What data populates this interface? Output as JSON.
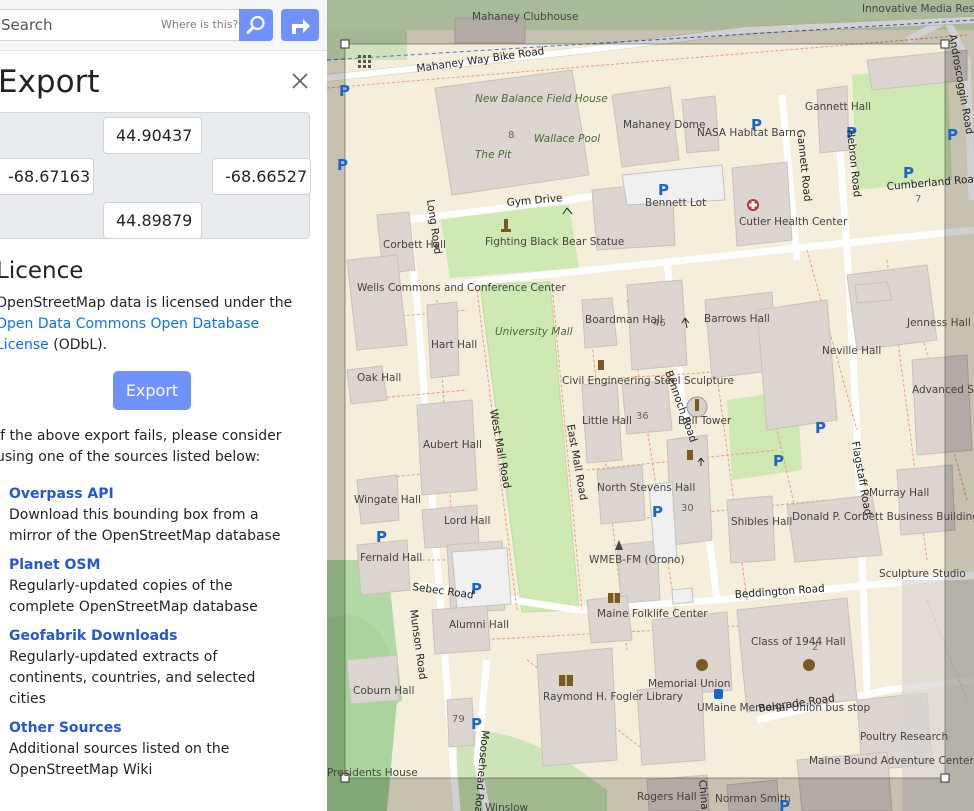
{
  "search": {
    "placeholder": "Search",
    "where_label": "Where is this?"
  },
  "export_panel": {
    "title": "Export",
    "max_lat": "44.90437",
    "min_lon": "-68.67163",
    "max_lon": "-68.66527",
    "min_lat": "44.89879",
    "licence_title": "Licence",
    "licence_prefix": "OpenStreetMap data is licensed under the",
    "licence_link": "Open Data Commons Open Database License",
    "licence_suffix": "(ODbL).",
    "export_button": "Export",
    "fail_text": "If the above export fails, please consider using one of the sources listed below:",
    "sources": [
      {
        "name": "Overpass API",
        "desc": "Download this bounding box from a mirror of the OpenStreetMap database"
      },
      {
        "name": "Planet OSM",
        "desc": "Regularly-updated copies of the complete OpenStreetMap database"
      },
      {
        "name": "Geofabrik Downloads",
        "desc": "Regularly-updated extracts of continents, countries, and selected cities"
      },
      {
        "name": "Other Sources",
        "desc": "Additional sources listed on the OpenStreetMap Wiki"
      }
    ]
  },
  "map": {
    "labels": {
      "mahaney_clubhouse": "Mahaney Clubhouse",
      "mahaney_way": "Mahaney Way Bike Road",
      "new_balance": "New Balance Field House",
      "the_pit": "The Pit",
      "wallace_pool": "Wallace Pool",
      "mahaney_dome": "Mahaney Dome",
      "nasa_barn": "NASA Habitat Barn",
      "gannett_hall": "Gannett Hall",
      "gannett_road": "Gannett Road",
      "hebron_road": "Hebron Road",
      "innovative_media": "Innovative Media Research and Commercialization Center",
      "androscoggin": "Androscoggin Road",
      "cumberland": "Cumberland Road",
      "bennett_lot": "Bennett Lot",
      "cutler": "Cutler Health Center",
      "gym_drive": "Gym Drive",
      "long_road": "Long Road",
      "fighting_bear": "Fighting Black Bear Statue",
      "corbett": "Corbett Hall",
      "wells": "Wells Commons and Conference Center",
      "hart": "Hart Hall",
      "oak": "Oak Hall",
      "university_mall": "University Mall",
      "boardman": "Boardman Hall",
      "barrows": "Barrows Hall",
      "jenness": "Jenness Hall",
      "neville": "Neville Hall",
      "civil_eng": "Civil Engineering Steel Sculpture",
      "bennoch": "Bennoch Road",
      "bell_tower": "Bell Tower",
      "advanced": "Advanced Structures and Composites Center",
      "flagstaff": "Flagstaff Road",
      "west_mall": "West Mall Road",
      "east_mall": "East Mall Road",
      "little_hall": "Little Hall",
      "aubert": "Aubert Hall",
      "wingate": "Wingate Hall",
      "north_stevens": "North Stevens Hall",
      "donald": "Donald P. Corbett Business Building",
      "murray": "Murray Hall",
      "shibles": "Shibles Hall",
      "lord": "Lord Hall",
      "wmeb": "WMEB-FM (Orono)",
      "fernald": "Fernald Hall",
      "sebec": "Sebec Road",
      "maine_folklife": "Maine Folklife Center",
      "beddington": "Beddington Road",
      "sculpture_studio": "Sculpture Studio",
      "alumni": "Alumni Hall",
      "munson": "Munson Road",
      "class1944": "Class of 1944 Hall",
      "coburn": "Coburn Hall",
      "raymond": "Raymond H. Fogler Library",
      "memorial_union": "Memorial Union",
      "umaine_bus": "UMaine Memorial Union bus stop",
      "belgrade": "Belgrade Road",
      "poultry": "Poultry Research",
      "presidents": "Presidents House",
      "moosehead": "Moosehead Road",
      "maine_bound": "Maine Bound Adventure Center",
      "winslow": "Winslow",
      "rogers": "Rogers Hall",
      "norman": "Norman Smith",
      "china": "China"
    },
    "numbers": [
      "8",
      "7",
      "46",
      "36",
      "30",
      "2",
      "79"
    ]
  },
  "colors": {
    "accent": "#7092ff",
    "link": "#0d6efd",
    "source_link": "#2456d8"
  }
}
